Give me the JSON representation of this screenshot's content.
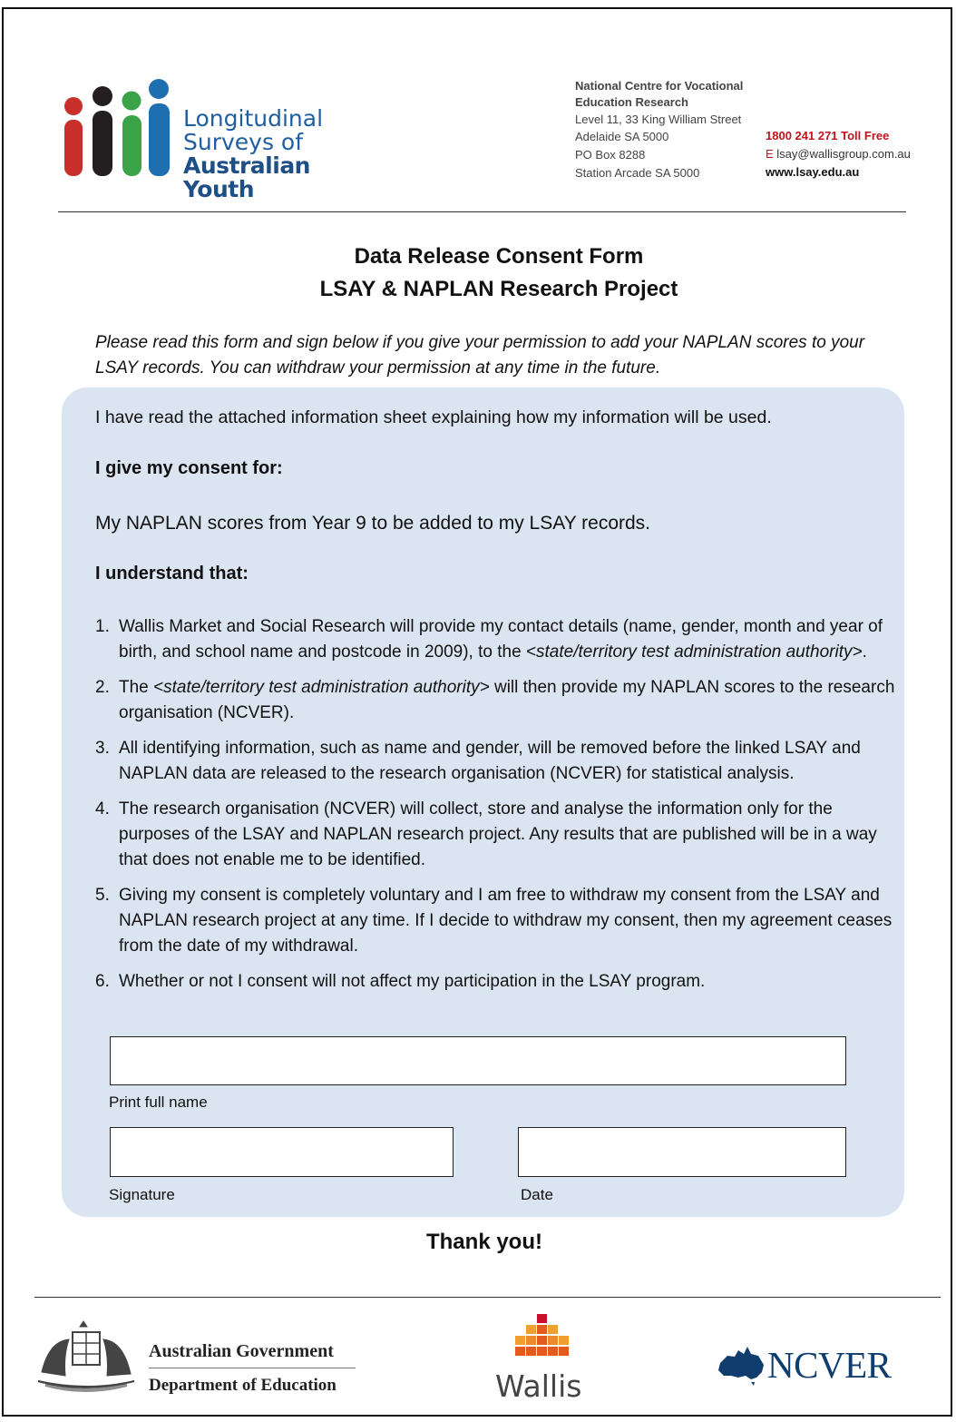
{
  "header": {
    "logo": {
      "name": "lsay-logo",
      "line1": "Longitudinal",
      "line2": "Surveys of",
      "line3": "Australian Youth",
      "colors": [
        "#c9302c",
        "#231f20",
        "#3aa348",
        "#1e6fb0"
      ]
    },
    "organisation": {
      "name_line1": "National Centre for Vocational",
      "name_line2": "Education Research",
      "address1": "Level 11, 33 King William Street",
      "address2": "Adelaide SA 5000",
      "address3": "PO Box 8288",
      "address4": "Station Arcade SA 5000"
    },
    "contact": {
      "phone": "1800 241 271 Toll Free",
      "email_prefix": "E",
      "email": "lsay@wallisgroup.com.au",
      "website": "www.lsay.edu.au"
    }
  },
  "title": {
    "line1": "Data Release Consent Form",
    "line2": "LSAY & NAPLAN Research Project"
  },
  "intro": {
    "line1": "Please read this form and sign below if you give your permission to add your NAPLAN scores to your",
    "line2": "LSAY records. You can withdraw your permission at any time in the future."
  },
  "consent": {
    "read_statement": "I have read the attached information sheet explaining how my information will be used.",
    "give_consent_heading": "I give my consent for:",
    "consent_item": "My NAPLAN scores from Year 9 to be added to my LSAY records.",
    "understand_heading": "I understand that:",
    "items": [
      {
        "num": "1.",
        "text_a": "Wallis Market and Social Research will provide my contact details (name, gender, month and year of birth, and school name and postcode in 2009), to the ",
        "text_italic": "<state/territory test administration authority>",
        "text_b": "."
      },
      {
        "num": "2.",
        "text_a": "The ",
        "text_italic": "<state/territory test administration authority>",
        "text_b": " will then provide my NAPLAN scores to the research organisation (NCVER)."
      },
      {
        "num": "3.",
        "text_a": "All identifying information, such as name and gender, will be removed before the linked LSAY and NAPLAN data are released to the research organisation (NCVER) for statistical analysis."
      },
      {
        "num": "4.",
        "text_a": "The research organisation (NCVER) will collect, store and analyse the information only for the purposes of the LSAY and NAPLAN research project. Any results that are published will be in a way that does not enable me to be identified."
      },
      {
        "num": "5.",
        "text_a": "Giving my consent is completely voluntary and I am free to withdraw my consent from the LSAY and NAPLAN research project at any time. If I decide to withdraw my consent, then my agreement ceases from the date of my withdrawal."
      },
      {
        "num": "6.",
        "text_a": "Whether or not I consent will not affect my participation in the LSAY program."
      }
    ]
  },
  "fields": {
    "name_label": "Print full name",
    "signature_label": "Signature",
    "date_label": "Date",
    "name_value": "",
    "signature_value": "",
    "date_value": ""
  },
  "closing": "Thank you!",
  "footer": {
    "gov_line1": "Australian Government",
    "gov_line2": "Department of Education",
    "wallis": "Wallis",
    "ncver": "NCVER",
    "colors": {
      "wallis_red": "#c8102e",
      "wallis_orange": "#f0a030",
      "ncver_navy": "#0f3d6e"
    }
  }
}
